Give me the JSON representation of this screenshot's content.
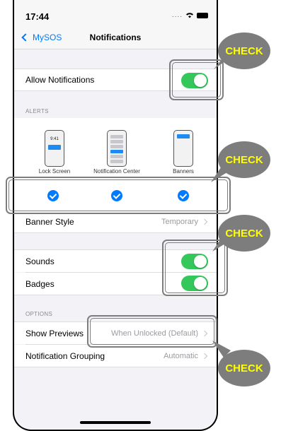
{
  "status_bar": {
    "time": "17:44",
    "dots": "....",
    "icons": [
      "wifi-icon",
      "battery-icon"
    ]
  },
  "nav": {
    "back_label": "MySOS",
    "title": "Notifications"
  },
  "allow_notifications": {
    "label": "Allow Notifications",
    "enabled": true
  },
  "alerts": {
    "header": "ALERTS",
    "mini_time": "9:41",
    "options": [
      {
        "label": "Lock Screen",
        "checked": true
      },
      {
        "label": "Notification Center",
        "checked": true
      },
      {
        "label": "Banners",
        "checked": true
      }
    ]
  },
  "banner_style": {
    "label": "Banner Style",
    "value": "Temporary"
  },
  "sounds": {
    "label": "Sounds",
    "enabled": true
  },
  "badges": {
    "label": "Badges",
    "enabled": true
  },
  "options": {
    "header": "OPTIONS",
    "show_previews": {
      "label": "Show Previews",
      "value": "When Unlocked (Default)"
    },
    "grouping": {
      "label": "Notification Grouping",
      "value": "Automatic"
    }
  },
  "callouts": {
    "check_label": "CHECK"
  },
  "colors": {
    "toggle_on": "#34c759",
    "accent": "#007aff",
    "callout_bg": "#7d7d7d",
    "callout_text": "#ffff00"
  }
}
